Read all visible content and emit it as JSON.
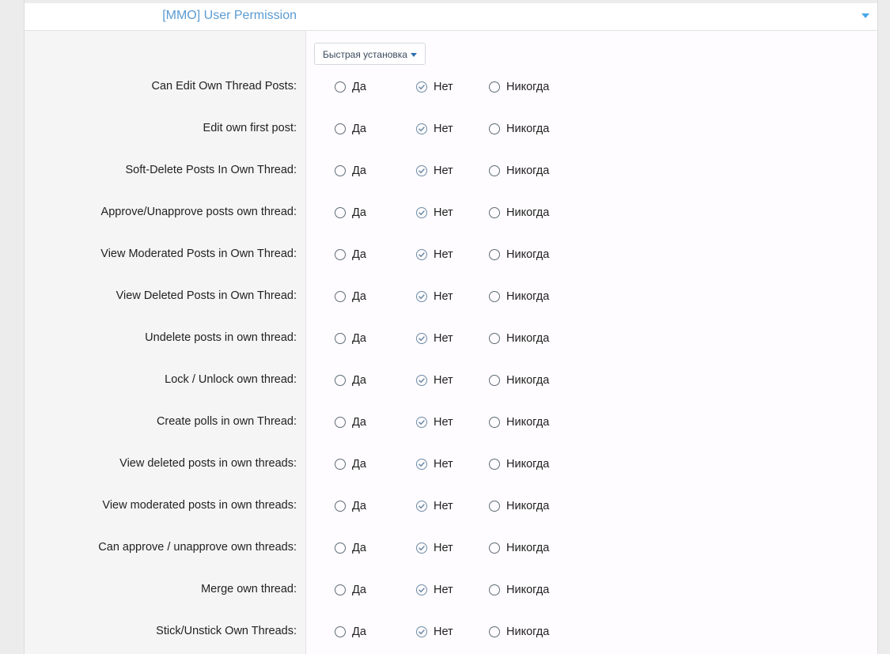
{
  "header": {
    "title": "[MMO] User Permission"
  },
  "quick_set": {
    "label": "Быстрая установка"
  },
  "options": [
    "Да",
    "Нет",
    "Никогда"
  ],
  "colors": {
    "accent": "#5b9bd1",
    "toggle": "#47a7eb",
    "label_bg": "#f5f5f5",
    "value_bg": "#fefcfe"
  },
  "rows": [
    {
      "label": "Can Edit Own Thread Posts:",
      "selected": "Нет"
    },
    {
      "label": "Edit own first post:",
      "selected": "Нет"
    },
    {
      "label": "Soft-Delete Posts In Own Thread:",
      "selected": "Нет"
    },
    {
      "label": "Approve/Unapprove posts own thread:",
      "selected": "Нет"
    },
    {
      "label": "View Moderated Posts in Own Thread:",
      "selected": "Нет"
    },
    {
      "label": "View Deleted Posts in Own Thread:",
      "selected": "Нет"
    },
    {
      "label": "Undelete posts in own thread:",
      "selected": "Нет"
    },
    {
      "label": "Lock / Unlock own thread:",
      "selected": "Нет"
    },
    {
      "label": "Create polls in own Thread:",
      "selected": "Нет"
    },
    {
      "label": "View deleted posts in own threads:",
      "selected": "Нет"
    },
    {
      "label": "View moderated posts in own threads:",
      "selected": "Нет"
    },
    {
      "label": "Can approve / unapprove own threads:",
      "selected": "Нет"
    },
    {
      "label": "Merge own thread:",
      "selected": "Нет"
    },
    {
      "label": "Stick/Unstick Own Threads:",
      "selected": "Нет"
    }
  ]
}
